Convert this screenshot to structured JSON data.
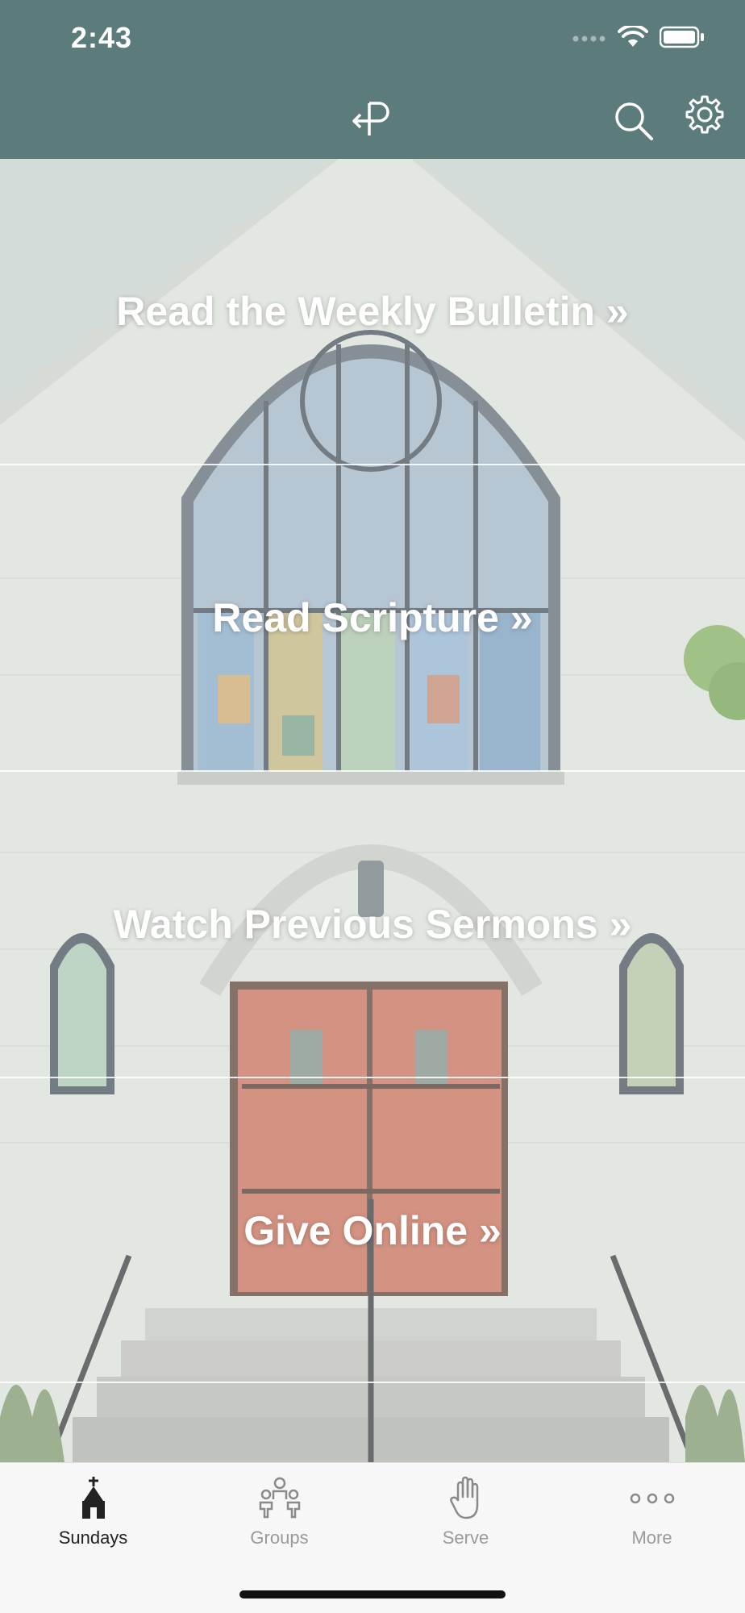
{
  "status": {
    "time": "2:43"
  },
  "header": {
    "logo_icon": "p-arrow-logo-icon",
    "search_icon": "search-icon",
    "settings_icon": "gear-icon"
  },
  "rows": [
    {
      "label": "Read the Weekly Bulletin »"
    },
    {
      "label": "Read Scripture »"
    },
    {
      "label": "Watch Previous Sermons »"
    },
    {
      "label": "Give Online »"
    }
  ],
  "tabs": [
    {
      "label": "Sundays",
      "icon": "church-icon",
      "active": true
    },
    {
      "label": "Groups",
      "icon": "group-icon",
      "active": false
    },
    {
      "label": "Serve",
      "icon": "hand-icon",
      "active": false
    },
    {
      "label": "More",
      "icon": "more-dots-icon",
      "active": false
    }
  ],
  "colors": {
    "header_bg": "#5b7c7a",
    "tabbar_bg": "#f7f7f7",
    "active_tab": "#222222",
    "inactive_tab": "#9a9a9a"
  }
}
